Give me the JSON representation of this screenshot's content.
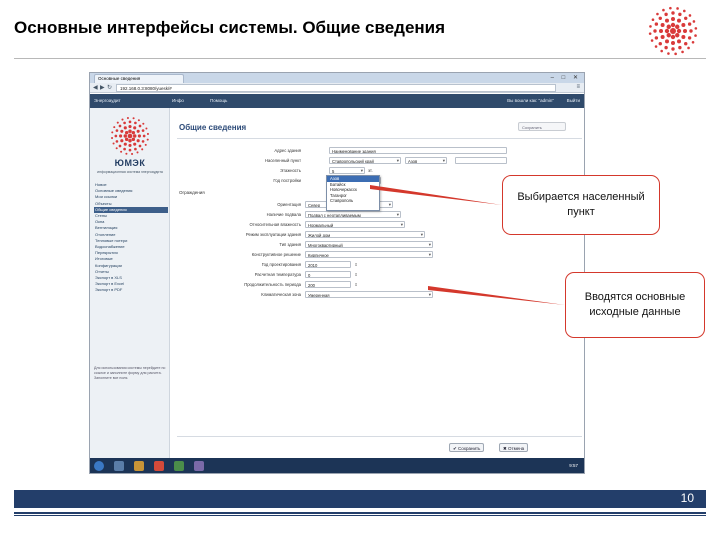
{
  "slide": {
    "title": "Основные интерфейсы системы. Общие сведения",
    "page_number": "10",
    "callouts": [
      "Выбирается населенный пункт",
      "Вводятся основные исходные данные"
    ]
  },
  "browser": {
    "tab": "Основные сведения",
    "url": "192.168.0.3:8080/yuesk/#"
  },
  "app": {
    "nav_items": [
      "Энергоаудит",
      "Инфо",
      "Помощь"
    ],
    "user": "Вы вошли как: \"admin\"",
    "exit": "Выйти",
    "brand": "ЮМЭК",
    "brand_sub": "информационная система энергоаудита",
    "sidebar": [
      "Новое",
      "Основные сведения",
      "Мои ссылки",
      "Объекты",
      "Общие сведения",
      "Стены",
      "Окна",
      "Вентиляция",
      "Отопление",
      "Тепловые потери",
      "Водоснабжение",
      "Перекрытия",
      "Итоговые",
      "Конфигурации",
      "Отчеты",
      "Экспорт в XLS",
      "Экспорт в Excel",
      "Экспорт в PDF"
    ],
    "sidebar_active_index": 4,
    "sidebar_note": "Для использования системы перейдите по ссылке и заполните форму для расчета. Заполните все поля.",
    "page_title": "Общие сведения",
    "header_pill": "Сохранить",
    "section_label": "Ограждения",
    "fields": [
      {
        "label": "Адрес здания",
        "value": "Наименование здания"
      },
      {
        "label": "Населенный пункт",
        "value": "Ставропольский край"
      },
      {
        "label": "Этажность",
        "value": "5"
      },
      {
        "label": "Год постройки",
        "value": ""
      },
      {
        "label": "Ориентация",
        "value": "Север"
      },
      {
        "label": "Наличие подвала",
        "value": "Подвал с неотапливаемым"
      },
      {
        "label": "Относительная влажность",
        "value": "Нормальный"
      },
      {
        "label": "Режим эксплуатации здания",
        "value": "Жилой дом"
      },
      {
        "label": "Тип здания",
        "value": "Многоквартирный"
      },
      {
        "label": "Конструктивное решение",
        "value": "Кирпичное"
      },
      {
        "label": "Год проектирования",
        "value": "2010"
      },
      {
        "label": "Расчетная температура",
        "value": "0"
      },
      {
        "label": "Продолжительность периода",
        "value": "200"
      },
      {
        "label": "Климатическая зона",
        "value": "Умеренная"
      }
    ],
    "city_select_value": "Азов",
    "dropdown_options": [
      "Азов",
      "Батайск",
      "Новочеркасск",
      "Таганрог",
      "Ставрополь"
    ],
    "dropdown_highlight": 0,
    "floors_unit": "эт.",
    "save_button": "Сохранить",
    "cancel_button": "Отмена",
    "clock": "9:57"
  },
  "colors": {
    "accent_red": "#d4382c",
    "brand_navy": "#233e6a"
  }
}
